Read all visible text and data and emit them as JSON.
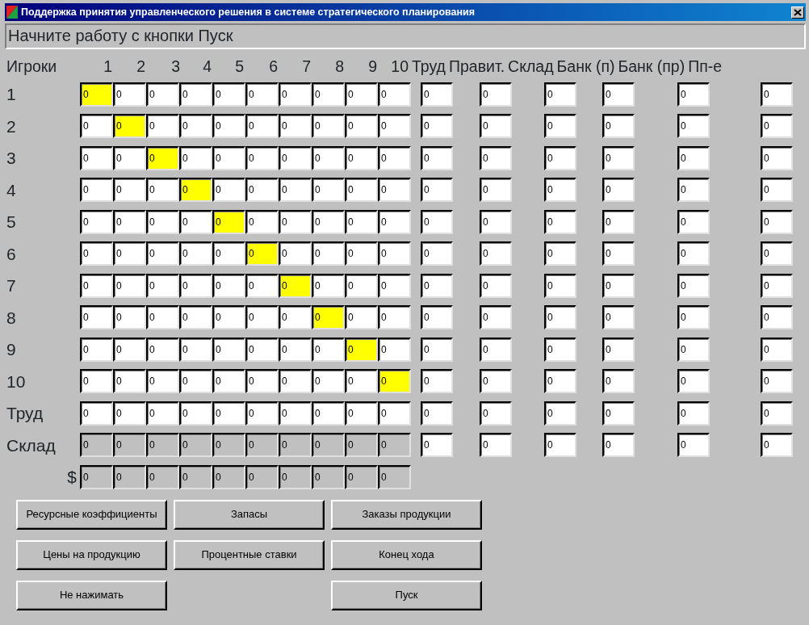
{
  "window": {
    "title": "Поддержка принятия управленческого решения в системе стратегического планирования"
  },
  "message": "Начните работу с кнопки Пуск",
  "columns": [
    "Игроки",
    "1",
    "2",
    "3",
    "4",
    "5",
    "6",
    "7",
    "8",
    "9",
    "10",
    "Труд",
    "Правит.",
    "Склад",
    "Банк (п)",
    "Банк (пр)",
    "Пп-е"
  ],
  "rows": [
    {
      "label": "1",
      "disabled": false,
      "cells": [
        {
          "value": "0",
          "highlighted": true
        },
        {
          "value": "0",
          "highlighted": false
        },
        {
          "value": "0",
          "highlighted": false
        },
        {
          "value": "0",
          "highlighted": false
        },
        {
          "value": "0",
          "highlighted": false
        },
        {
          "value": "0",
          "highlighted": false
        },
        {
          "value": "0",
          "highlighted": false
        },
        {
          "value": "0",
          "highlighted": false
        },
        {
          "value": "0",
          "highlighted": false
        },
        {
          "value": "0",
          "highlighted": false
        }
      ],
      "extra_cells": [
        "0",
        "0",
        "0",
        "0",
        "0",
        "0"
      ]
    },
    {
      "label": "2",
      "disabled": false,
      "cells": [
        {
          "value": "0",
          "highlighted": false
        },
        {
          "value": "0",
          "highlighted": true
        },
        {
          "value": "0",
          "highlighted": false
        },
        {
          "value": "0",
          "highlighted": false
        },
        {
          "value": "0",
          "highlighted": false
        },
        {
          "value": "0",
          "highlighted": false
        },
        {
          "value": "0",
          "highlighted": false
        },
        {
          "value": "0",
          "highlighted": false
        },
        {
          "value": "0",
          "highlighted": false
        },
        {
          "value": "0",
          "highlighted": false
        }
      ],
      "extra_cells": [
        "0",
        "0",
        "0",
        "0",
        "0",
        "0"
      ]
    },
    {
      "label": "3",
      "disabled": false,
      "cells": [
        {
          "value": "0",
          "highlighted": false
        },
        {
          "value": "0",
          "highlighted": false
        },
        {
          "value": "0",
          "highlighted": true
        },
        {
          "value": "0",
          "highlighted": false
        },
        {
          "value": "0",
          "highlighted": false
        },
        {
          "value": "0",
          "highlighted": false
        },
        {
          "value": "0",
          "highlighted": false
        },
        {
          "value": "0",
          "highlighted": false
        },
        {
          "value": "0",
          "highlighted": false
        },
        {
          "value": "0",
          "highlighted": false
        }
      ],
      "extra_cells": [
        "0",
        "0",
        "0",
        "0",
        "0",
        "0"
      ]
    },
    {
      "label": "4",
      "disabled": false,
      "cells": [
        {
          "value": "0",
          "highlighted": false
        },
        {
          "value": "0",
          "highlighted": false
        },
        {
          "value": "0",
          "highlighted": false
        },
        {
          "value": "0",
          "highlighted": true
        },
        {
          "value": "0",
          "highlighted": false
        },
        {
          "value": "0",
          "highlighted": false
        },
        {
          "value": "0",
          "highlighted": false
        },
        {
          "value": "0",
          "highlighted": false
        },
        {
          "value": "0",
          "highlighted": false
        },
        {
          "value": "0",
          "highlighted": false
        }
      ],
      "extra_cells": [
        "0",
        "0",
        "0",
        "0",
        "0",
        "0"
      ]
    },
    {
      "label": "5",
      "disabled": false,
      "cells": [
        {
          "value": "0",
          "highlighted": false
        },
        {
          "value": "0",
          "highlighted": false
        },
        {
          "value": "0",
          "highlighted": false
        },
        {
          "value": "0",
          "highlighted": false
        },
        {
          "value": "0",
          "highlighted": true
        },
        {
          "value": "0",
          "highlighted": false
        },
        {
          "value": "0",
          "highlighted": false
        },
        {
          "value": "0",
          "highlighted": false
        },
        {
          "value": "0",
          "highlighted": false
        },
        {
          "value": "0",
          "highlighted": false
        }
      ],
      "extra_cells": [
        "0",
        "0",
        "0",
        "0",
        "0",
        "0"
      ]
    },
    {
      "label": "6",
      "disabled": false,
      "cells": [
        {
          "value": "0",
          "highlighted": false
        },
        {
          "value": "0",
          "highlighted": false
        },
        {
          "value": "0",
          "highlighted": false
        },
        {
          "value": "0",
          "highlighted": false
        },
        {
          "value": "0",
          "highlighted": false
        },
        {
          "value": "0",
          "highlighted": true
        },
        {
          "value": "0",
          "highlighted": false
        },
        {
          "value": "0",
          "highlighted": false
        },
        {
          "value": "0",
          "highlighted": false
        },
        {
          "value": "0",
          "highlighted": false
        }
      ],
      "extra_cells": [
        "0",
        "0",
        "0",
        "0",
        "0",
        "0"
      ]
    },
    {
      "label": "7",
      "disabled": false,
      "cells": [
        {
          "value": "0",
          "highlighted": false
        },
        {
          "value": "0",
          "highlighted": false
        },
        {
          "value": "0",
          "highlighted": false
        },
        {
          "value": "0",
          "highlighted": false
        },
        {
          "value": "0",
          "highlighted": false
        },
        {
          "value": "0",
          "highlighted": false
        },
        {
          "value": "0",
          "highlighted": true
        },
        {
          "value": "0",
          "highlighted": false
        },
        {
          "value": "0",
          "highlighted": false
        },
        {
          "value": "0",
          "highlighted": false
        }
      ],
      "extra_cells": [
        "0",
        "0",
        "0",
        "0",
        "0",
        "0"
      ]
    },
    {
      "label": "8",
      "disabled": false,
      "cells": [
        {
          "value": "0",
          "highlighted": false
        },
        {
          "value": "0",
          "highlighted": false
        },
        {
          "value": "0",
          "highlighted": false
        },
        {
          "value": "0",
          "highlighted": false
        },
        {
          "value": "0",
          "highlighted": false
        },
        {
          "value": "0",
          "highlighted": false
        },
        {
          "value": "0",
          "highlighted": false
        },
        {
          "value": "0",
          "highlighted": true
        },
        {
          "value": "0",
          "highlighted": false
        },
        {
          "value": "0",
          "highlighted": false
        }
      ],
      "extra_cells": [
        "0",
        "0",
        "0",
        "0",
        "0",
        "0"
      ]
    },
    {
      "label": "9",
      "disabled": false,
      "cells": [
        {
          "value": "0",
          "highlighted": false
        },
        {
          "value": "0",
          "highlighted": false
        },
        {
          "value": "0",
          "highlighted": false
        },
        {
          "value": "0",
          "highlighted": false
        },
        {
          "value": "0",
          "highlighted": false
        },
        {
          "value": "0",
          "highlighted": false
        },
        {
          "value": "0",
          "highlighted": false
        },
        {
          "value": "0",
          "highlighted": false
        },
        {
          "value": "0",
          "highlighted": true
        },
        {
          "value": "0",
          "highlighted": false
        }
      ],
      "extra_cells": [
        "0",
        "0",
        "0",
        "0",
        "0",
        "0"
      ]
    },
    {
      "label": "10",
      "disabled": false,
      "cells": [
        {
          "value": "0",
          "highlighted": false
        },
        {
          "value": "0",
          "highlighted": false
        },
        {
          "value": "0",
          "highlighted": false
        },
        {
          "value": "0",
          "highlighted": false
        },
        {
          "value": "0",
          "highlighted": false
        },
        {
          "value": "0",
          "highlighted": false
        },
        {
          "value": "0",
          "highlighted": false
        },
        {
          "value": "0",
          "highlighted": false
        },
        {
          "value": "0",
          "highlighted": false
        },
        {
          "value": "0",
          "highlighted": true
        }
      ],
      "extra_cells": [
        "0",
        "0",
        "0",
        "0",
        "0",
        "0"
      ]
    },
    {
      "label": "Труд",
      "disabled": false,
      "cells": [
        {
          "value": "0",
          "highlighted": false
        },
        {
          "value": "0",
          "highlighted": false
        },
        {
          "value": "0",
          "highlighted": false
        },
        {
          "value": "0",
          "highlighted": false
        },
        {
          "value": "0",
          "highlighted": false
        },
        {
          "value": "0",
          "highlighted": false
        },
        {
          "value": "0",
          "highlighted": false
        },
        {
          "value": "0",
          "highlighted": false
        },
        {
          "value": "0",
          "highlighted": false
        },
        {
          "value": "0",
          "highlighted": false
        }
      ],
      "extra_cells": [
        "0",
        "0",
        "0",
        "0",
        "0",
        "0"
      ]
    },
    {
      "label": "Склад",
      "disabled": true,
      "cells": [
        {
          "value": "0",
          "highlighted": false
        },
        {
          "value": "0",
          "highlighted": false
        },
        {
          "value": "0",
          "highlighted": false
        },
        {
          "value": "0",
          "highlighted": false
        },
        {
          "value": "0",
          "highlighted": false
        },
        {
          "value": "0",
          "highlighted": false
        },
        {
          "value": "0",
          "highlighted": false
        },
        {
          "value": "0",
          "highlighted": false
        },
        {
          "value": "0",
          "highlighted": false
        },
        {
          "value": "0",
          "highlighted": false
        }
      ],
      "extra_cells": [
        "0",
        "0",
        "0",
        "0",
        "0",
        "0"
      ]
    },
    {
      "label": "$",
      "disabled": true,
      "cells": [
        {
          "value": "0",
          "highlighted": false
        },
        {
          "value": "0",
          "highlighted": false
        },
        {
          "value": "0",
          "highlighted": false
        },
        {
          "value": "0",
          "highlighted": false
        },
        {
          "value": "0",
          "highlighted": false
        },
        {
          "value": "0",
          "highlighted": false
        },
        {
          "value": "0",
          "highlighted": false
        },
        {
          "value": "0",
          "highlighted": false
        },
        {
          "value": "0",
          "highlighted": false
        },
        {
          "value": "0",
          "highlighted": false
        }
      ]
    }
  ],
  "button_rows": [
    [
      "Ресурсные коэффициенты",
      "Запасы",
      "Заказы продукции"
    ],
    [
      "Цены на продукцию",
      "Процентные ставки",
      "Конец хода"
    ],
    [
      "Не нажимать",
      "Пуск"
    ]
  ]
}
